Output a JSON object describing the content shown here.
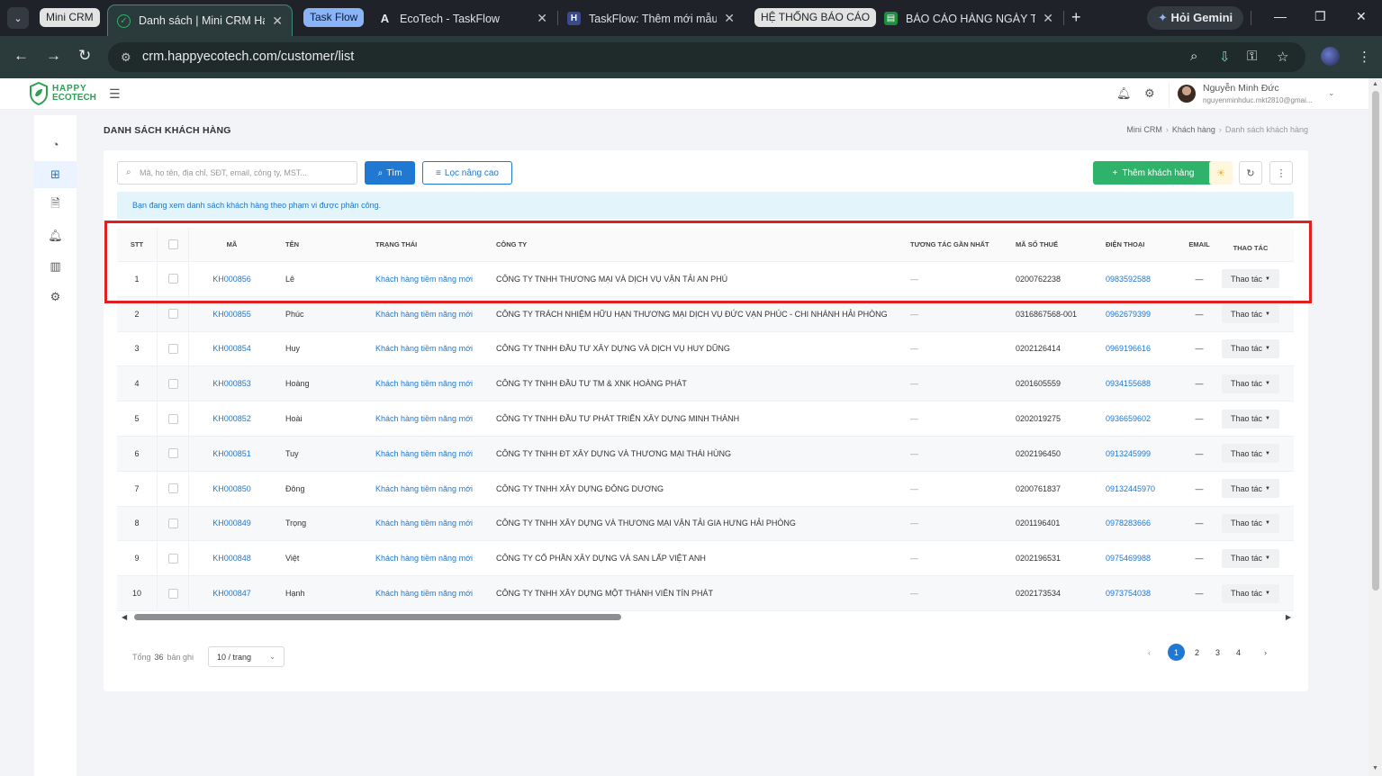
{
  "browser": {
    "group_chips": [
      "Mini CRM",
      "Task Flow",
      "HỆ THỐNG BÁO CÁO"
    ],
    "tabs": [
      {
        "title": "Danh sách | Mini CRM Hap",
        "active": true
      },
      {
        "title": "EcoTech - TaskFlow"
      },
      {
        "title": "TaskFlow: Thêm mới mẫu c"
      },
      {
        "title": "BÁO CÁO HÀNG NGÀY TE"
      }
    ],
    "gemini_label": "Hỏi Gemini",
    "url": "crm.happyecotech.com/customer/list"
  },
  "app": {
    "logo_line1": "HAPPY",
    "logo_line2": "ECOTECH",
    "user_name": "Nguyễn Minh Đức",
    "user_email": "nguyenminhduc.mkt2810@gmai..."
  },
  "page": {
    "title": "DANH SÁCH KHÁCH HÀNG",
    "breadcrumb": [
      "Mini CRM",
      "Khách hàng",
      "Danh sách khách hàng"
    ]
  },
  "toolbar": {
    "search_placeholder": "Mã, họ tên, địa chỉ, SĐT, email, công ty, MST...",
    "find_label": "Tìm",
    "filter_label": "Lọc nâng cao",
    "add_label": "Thêm khách hàng"
  },
  "notice": "Bạn đang xem danh sách khách hàng theo phạm vi được phân công.",
  "table": {
    "headers": {
      "stt": "STT",
      "ma": "Mã",
      "ten": "Tên",
      "trang_thai": "Trạng thái",
      "cong_ty": "Công ty",
      "tuong_tac": "Tương tác gần nhất",
      "mst": "Mã số thuế",
      "dien_thoai": "Điện thoại",
      "email": "Email",
      "thao_tac": "Thao tác"
    },
    "rows": [
      {
        "stt": "1",
        "ma": "KH000856",
        "ten": "Lê",
        "trang_thai": "Khách hàng tiềm năng mới",
        "cong_ty": "CÔNG TY TNHH THƯƠNG MẠI VÀ DỊCH VỤ VẬN TẢI AN PHÚ",
        "tuong_tac": "—",
        "mst": "0200762238",
        "dien_thoai": "0983592588",
        "email": "—",
        "thao_tac": "Thao tác"
      },
      {
        "stt": "2",
        "ma": "KH000855",
        "ten": "Phúc",
        "trang_thai": "Khách hàng tiềm năng mới",
        "cong_ty": "CÔNG TY TRÁCH NHIỆM HỮU HẠN THƯƠNG MẠI DỊCH VỤ ĐỨC VẠN PHÚC - CHI NHÁNH HẢI PHÒNG",
        "tuong_tac": "—",
        "mst": "0316867568-001",
        "dien_thoai": "0962679399",
        "email": "—",
        "thao_tac": "Thao tác"
      },
      {
        "stt": "3",
        "ma": "KH000854",
        "ten": "Huy",
        "trang_thai": "Khách hàng tiềm năng mới",
        "cong_ty": "CÔNG TY TNHH ĐẦU TƯ XÂY DỰNG VÀ DỊCH VỤ HUY DŨNG",
        "tuong_tac": "—",
        "mst": "0202126414",
        "dien_thoai": "0969196616",
        "email": "—",
        "thao_tac": "Thao tác"
      },
      {
        "stt": "4",
        "ma": "KH000853",
        "ten": "Hoàng",
        "trang_thai": "Khách hàng tiềm năng mới",
        "cong_ty": "CÔNG TY TNHH ĐẦU TƯ TM & XNK HOÀNG PHÁT",
        "tuong_tac": "—",
        "mst": "0201605559",
        "dien_thoai": "0934155688",
        "email": "—",
        "thao_tac": "Thao tác"
      },
      {
        "stt": "5",
        "ma": "KH000852",
        "ten": "Hoài",
        "trang_thai": "Khách hàng tiềm năng mới",
        "cong_ty": "CÔNG TY TNHH ĐẦU TƯ PHÁT TRIỂN XÂY DỰNG MINH THÀNH",
        "tuong_tac": "—",
        "mst": "0202019275",
        "dien_thoai": "0936659602",
        "email": "—",
        "thao_tac": "Thao tác"
      },
      {
        "stt": "6",
        "ma": "KH000851",
        "ten": "Tuy",
        "trang_thai": "Khách hàng tiềm năng mới",
        "cong_ty": "CÔNG TY TNHH ĐT XÂY DỰNG VÀ THƯƠNG MẠI THÁI HÙNG",
        "tuong_tac": "—",
        "mst": "0202196450",
        "dien_thoai": "0913245999",
        "email": "—",
        "thao_tac": "Thao tác"
      },
      {
        "stt": "7",
        "ma": "KH000850",
        "ten": "Đông",
        "trang_thai": "Khách hàng tiềm năng mới",
        "cong_ty": "CÔNG TY TNHH XÂY DỰNG ĐÔNG DƯƠNG",
        "tuong_tac": "—",
        "mst": "0200761837",
        "dien_thoai": "09132445970",
        "email": "—",
        "thao_tac": "Thao tác"
      },
      {
        "stt": "8",
        "ma": "KH000849",
        "ten": "Trọng",
        "trang_thai": "Khách hàng tiềm năng mới",
        "cong_ty": "CÔNG TY TNHH XÂY DỰNG VÀ THƯƠNG MẠI VẬN TẢI GIA HƯNG HẢI PHÒNG",
        "tuong_tac": "—",
        "mst": "0201196401",
        "dien_thoai": "0978283666",
        "email": "—",
        "thao_tac": "Thao tác"
      },
      {
        "stt": "9",
        "ma": "KH000848",
        "ten": "Việt",
        "trang_thai": "Khách hàng tiềm năng mới",
        "cong_ty": "CÔNG TY CỔ PHẦN XÂY DỰNG VÀ SAN LẤP VIỆT ANH",
        "tuong_tac": "—",
        "mst": "0202196531",
        "dien_thoai": "0975469988",
        "email": "—",
        "thao_tac": "Thao tác"
      },
      {
        "stt": "10",
        "ma": "KH000847",
        "ten": "Hạnh",
        "trang_thai": "Khách hàng tiềm năng mới",
        "cong_ty": "CÔNG TY TNHH XÂY DỰNG MỘT THÀNH VIÊN TÍN PHÁT",
        "tuong_tac": "—",
        "mst": "0202173534",
        "dien_thoai": "0973754038",
        "email": "—",
        "thao_tac": "Thao tác"
      }
    ]
  },
  "footer": {
    "total_prefix": "Tổng",
    "total_count": "36",
    "total_suffix": "bản ghi",
    "per_page": "10 / trang",
    "pages": [
      "1",
      "2",
      "3",
      "4"
    ],
    "current_page": "1"
  },
  "colors": {
    "primary": "#1f78d1",
    "add_button": "#2fb36a",
    "highlight_box": "#e02020",
    "notice_bg": "#e3f4fb"
  }
}
